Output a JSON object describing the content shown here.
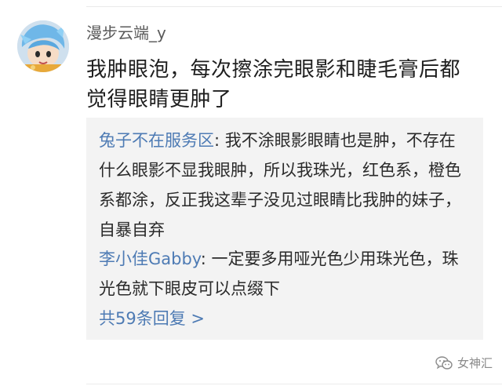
{
  "comment": {
    "username": "漫步云端_y",
    "text": "我肿眼泡，每次擦涂完眼影和睫毛膏后都觉得眼睛更肿了"
  },
  "replies": [
    {
      "author": "兔子不在服务区",
      "separator": ": ",
      "text": "我不涂眼影眼睛也是肿，不存在什么眼影不显我眼肿，所以我珠光，红色系，橙色系都涂，反正我这辈子没见过眼睛比我肿的妹子，自暴自弃"
    },
    {
      "author": "李小佳Gabby",
      "separator": ": ",
      "text": "一定要多用哑光色少用珠光色，珠光色就下眼皮可以点缀下"
    }
  ],
  "more_replies_label": "共59条回复 >",
  "watermark": {
    "icon": "wechat-icon",
    "text": "女神汇"
  },
  "colors": {
    "author_link": "#4e7bb4",
    "reply_background": "#f3f3f3",
    "username": "#5a5a5a"
  }
}
